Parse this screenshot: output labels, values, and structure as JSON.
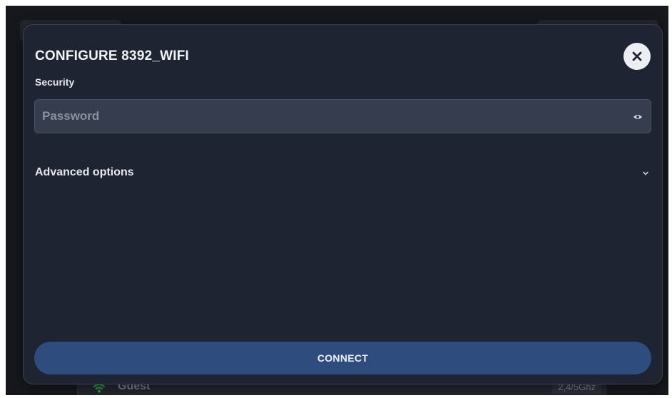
{
  "background": {
    "network_row": {
      "name": "Guest",
      "band": "2,4/5Ghz",
      "icon": "wifi-icon"
    }
  },
  "dialog": {
    "title": "CONFIGURE 8392_WIFI",
    "close_icon": "close-icon",
    "security_label": "Security",
    "password": {
      "value": "",
      "placeholder": "Password",
      "toggle_icon": "eye-icon"
    },
    "advanced": {
      "label": "Advanced options",
      "icon": "chevron-down-icon"
    },
    "connect_label": "CONNECT"
  },
  "colors": {
    "modal_bg": "#1f2433",
    "input_bg": "#363d4e",
    "connect_bg": "#2e4d7e",
    "close_bg": "#eceef2",
    "wifi_green": "#2e9a4a"
  }
}
